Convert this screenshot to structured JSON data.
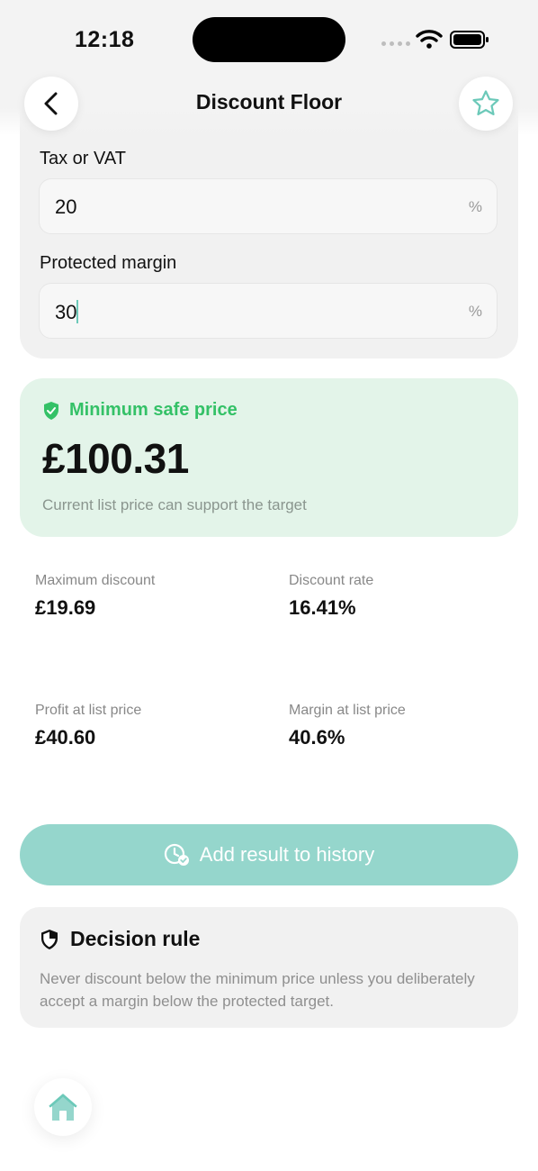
{
  "status_bar": {
    "time": "12:18"
  },
  "header": {
    "title": "Discount Floor"
  },
  "inputs": {
    "tax": {
      "label": "Tax or VAT",
      "value": "20",
      "unit": "%"
    },
    "margin": {
      "label": "Protected margin",
      "value": "30",
      "unit": "%"
    }
  },
  "result": {
    "title": "Minimum safe price",
    "price": "£100.31",
    "subtitle": "Current list price can support the target"
  },
  "stats": [
    {
      "label": "Maximum discount",
      "value": "£19.69"
    },
    {
      "label": "Discount rate",
      "value": "16.41%"
    },
    {
      "label": "Profit at list price",
      "value": "£40.60"
    },
    {
      "label": "Margin at list price",
      "value": "40.6%"
    }
  ],
  "history_button": {
    "label": "Add result to history"
  },
  "decision": {
    "title": "Decision rule",
    "text": "Never discount below the minimum price unless you deliberately accept a margin below the protected target."
  },
  "colors": {
    "accent": "#95d6cc",
    "success": "#34c167",
    "success_bg": "#e3f4e9"
  }
}
